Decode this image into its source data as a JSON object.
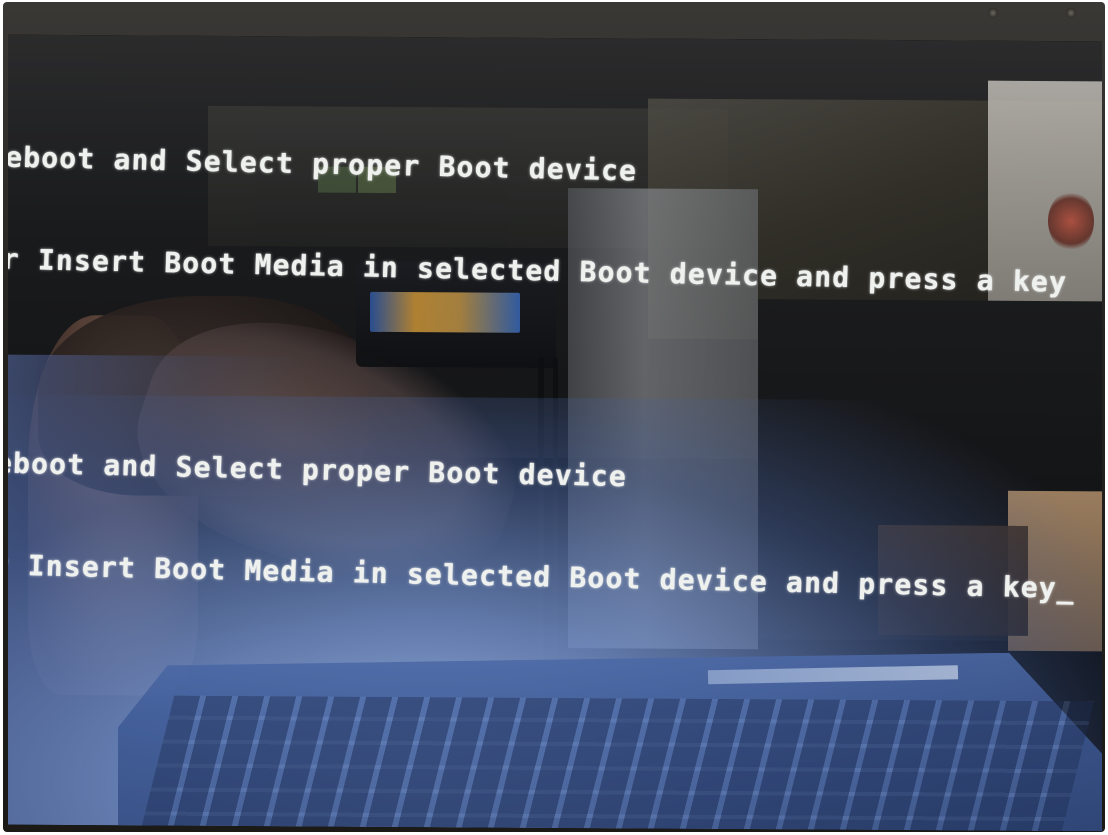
{
  "screen": {
    "console_lines": [
      "eboot and Select proper Boot device",
      "r Insert Boot Media in selected Boot device and press a key",
      "",
      "eboot and Select proper Boot device",
      "r Insert Boot Media in selected Boot device and press a key"
    ],
    "cursor": "_",
    "text_color": "#eef1ee",
    "background_color": "#07080a"
  }
}
